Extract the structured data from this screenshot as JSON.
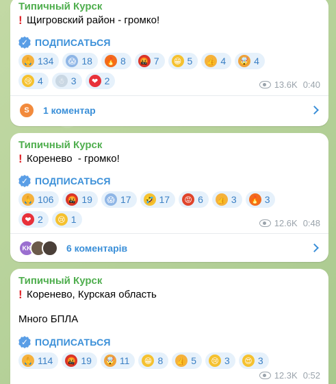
{
  "posts": [
    {
      "channel": "Типичный Курск",
      "lines": [
        "Щигровский район - громко!"
      ],
      "subscribe": "ПОДПИСАТЬСЯ",
      "reactions": [
        {
          "icon": "folded-hands-icon",
          "glyph": "🙏",
          "bg": "#f5b13c",
          "count": "134"
        },
        {
          "icon": "screaming-face-icon",
          "glyph": "😱",
          "bg": "#8fb6e6",
          "count": "18"
        },
        {
          "icon": "fire-icon",
          "glyph": "🔥",
          "bg": "#f26b1d",
          "count": "8"
        },
        {
          "icon": "cursing-face-icon",
          "glyph": "🤬",
          "bg": "#d9352b",
          "count": "7"
        },
        {
          "icon": "grinning-face-icon",
          "glyph": "😁",
          "bg": "#f5c12f",
          "count": "5"
        },
        {
          "icon": "thumbs-up-icon",
          "glyph": "👍",
          "bg": "#f5b13c",
          "count": "4"
        },
        {
          "icon": "exploding-head-icon",
          "glyph": "🤯",
          "bg": "#f0a23a",
          "count": "4"
        },
        {
          "icon": "crying-face-icon",
          "glyph": "😢",
          "bg": "#f5c12f",
          "count": "4"
        },
        {
          "icon": "snowman-icon",
          "glyph": "☃",
          "bg": "#c9d7e3",
          "count": "3"
        },
        {
          "icon": "red-heart-icon",
          "glyph": "❤",
          "bg": "#e8313a",
          "count": "2"
        }
      ],
      "views": "13.6K",
      "time": "0:40",
      "comments": {
        "label": "1 коментар",
        "avatars": [
          {
            "letter": "S",
            "color": "#f28a3c"
          }
        ]
      }
    },
    {
      "channel": "Типичный Курск",
      "lines": [
        "Коренево  - громко!"
      ],
      "subscribe": "ПОДПИСАТЬСЯ",
      "reactions": [
        {
          "icon": "folded-hands-icon",
          "glyph": "🙏",
          "bg": "#f5b13c",
          "count": "106"
        },
        {
          "icon": "cursing-face-icon",
          "glyph": "🤬",
          "bg": "#d9352b",
          "count": "19"
        },
        {
          "icon": "screaming-face-icon",
          "glyph": "😱",
          "bg": "#8fb6e6",
          "count": "17"
        },
        {
          "icon": "rofl-face-icon",
          "glyph": "🤣",
          "bg": "#f5c12f",
          "count": "17"
        },
        {
          "icon": "angry-face-icon",
          "glyph": "😡",
          "bg": "#e0442b",
          "count": "6"
        },
        {
          "icon": "thumbs-up-icon",
          "glyph": "👍",
          "bg": "#f5b13c",
          "count": "3"
        },
        {
          "icon": "fire-icon",
          "glyph": "🔥",
          "bg": "#f26b1d",
          "count": "3"
        },
        {
          "icon": "red-heart-icon",
          "glyph": "❤",
          "bg": "#e8313a",
          "count": "2"
        },
        {
          "icon": "crying-face-icon",
          "glyph": "😢",
          "bg": "#f5c12f",
          "count": "1"
        }
      ],
      "views": "12.6K",
      "time": "0:48",
      "comments": {
        "label": "6 коментарів",
        "avatars": [
          {
            "letter": "KK",
            "color": "#9b6fd0"
          },
          {
            "letter": "",
            "color": "#6b5a4a"
          },
          {
            "letter": "",
            "color": "#4a3f38"
          }
        ]
      }
    },
    {
      "channel": "Типичный Курск",
      "lines": [
        "Коренево, Курская область",
        "",
        "Много БПЛА"
      ],
      "subscribe": "ПОДПИСАТЬСЯ",
      "reactions": [
        {
          "icon": "folded-hands-icon",
          "glyph": "🙏",
          "bg": "#f5b13c",
          "count": "114"
        },
        {
          "icon": "cursing-face-icon",
          "glyph": "🤬",
          "bg": "#d9352b",
          "count": "19"
        },
        {
          "icon": "exploding-head-icon",
          "glyph": "🤯",
          "bg": "#f0a23a",
          "count": "11"
        },
        {
          "icon": "grinning-face-icon",
          "glyph": "😁",
          "bg": "#f5c12f",
          "count": "8"
        },
        {
          "icon": "thumbs-up-icon",
          "glyph": "👍",
          "bg": "#f5b13c",
          "count": "5"
        },
        {
          "icon": "crying-face-icon",
          "glyph": "😢",
          "bg": "#f5c12f",
          "count": "3"
        },
        {
          "icon": "heart-eyes-icon",
          "glyph": "😍",
          "bg": "#f5c12f",
          "count": "3"
        }
      ],
      "views": "12.3K",
      "time": "0:52"
    }
  ]
}
